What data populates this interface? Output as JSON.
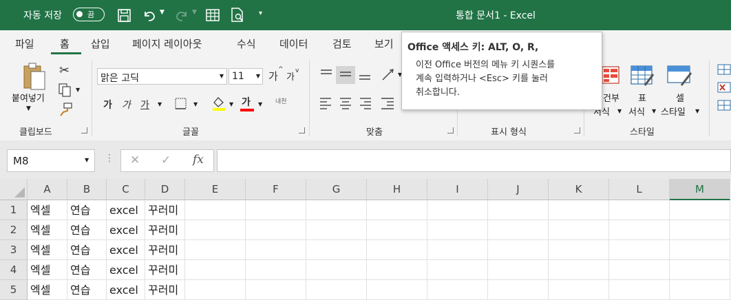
{
  "titlebar": {
    "autosave_label": "자동 저장",
    "toggle_label": "끔",
    "document_title": "통합 문서1  -  Excel"
  },
  "tabs": [
    "파일",
    "홈",
    "삽입",
    "페이지 레이아웃",
    "수식",
    "데이터",
    "검토",
    "보기"
  ],
  "active_tab": "홈",
  "tooltip": {
    "title": "Office 액세스 키: ALT, O, R,",
    "body_line1": "이전 Office 버전의 메뉴 키 시퀀스를",
    "body_line2": "계속 입력하거나 <Esc> 키를 눌러",
    "body_line3": "취소합니다."
  },
  "ribbon": {
    "clipboard": {
      "paste_label": "붙여넣기",
      "group_label": "클립보드"
    },
    "font": {
      "font_name": "맑은 고딕",
      "font_size": "11",
      "grow_label": "가",
      "shrink_label": "가",
      "bold_label": "가",
      "italic_label": "가",
      "underline_label": "가",
      "font_color_label": "가",
      "phonetic_label": "내천",
      "group_label": "글꼴"
    },
    "alignment": {
      "group_label": "맞춤"
    },
    "number": {
      "group_label": "표시 형식"
    },
    "styles": {
      "conditional_label1": "건부",
      "conditional_label2": "서식",
      "table_label1": "표",
      "table_label2": "서식",
      "cell_label1": "셀",
      "cell_label2": "스타일",
      "group_label": "스타일"
    }
  },
  "formula_bar": {
    "name_box": "M8",
    "cancel_glyph": "✕",
    "enter_glyph": "✓",
    "fx_label": "fx",
    "formula": ""
  },
  "sheet": {
    "columns": [
      "A",
      "B",
      "C",
      "D",
      "E",
      "F",
      "G",
      "H",
      "I",
      "J",
      "K",
      "L",
      "M"
    ],
    "selected_column": "M",
    "rows": [
      {
        "num": "1",
        "cells": [
          "엑셀",
          "연습",
          "excel",
          "꾸러미"
        ]
      },
      {
        "num": "2",
        "cells": [
          "엑셀",
          "연습",
          "excel",
          "꾸러미"
        ]
      },
      {
        "num": "3",
        "cells": [
          "엑셀",
          "연습",
          "excel",
          "꾸러미"
        ]
      },
      {
        "num": "4",
        "cells": [
          "엑셀",
          "연습",
          "excel",
          "꾸러미"
        ]
      },
      {
        "num": "5",
        "cells": [
          "엑셀",
          "연습",
          "excel",
          "꾸러미"
        ]
      }
    ]
  },
  "colors": {
    "accent": "#217346",
    "ribbon_bg": "#f3f3f3",
    "header_bg": "#e6e6e6"
  }
}
